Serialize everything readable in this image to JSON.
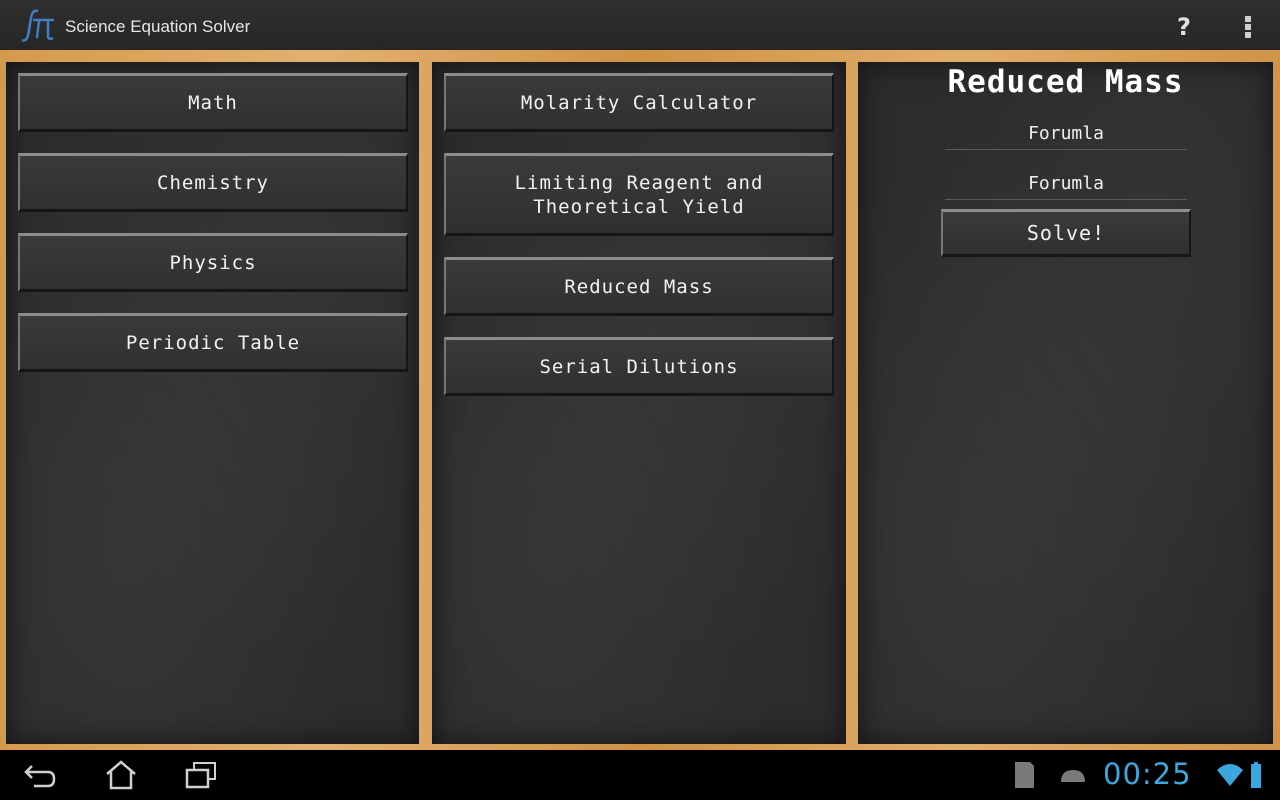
{
  "app": {
    "title": "Science Equation Solver",
    "logo_icon": "pi-formula-icon"
  },
  "actionbar": {
    "help_label": "?",
    "overflow_icon": "overflow-menu-icon"
  },
  "categories": [
    {
      "label": "Math"
    },
    {
      "label": "Chemistry"
    },
    {
      "label": "Physics"
    },
    {
      "label": "Periodic Table"
    }
  ],
  "equations": [
    {
      "label": "Molarity Calculator"
    },
    {
      "label": "Limiting Reagent and\nTheoretical Yield"
    },
    {
      "label": "Reduced Mass"
    },
    {
      "label": "Serial Dilutions"
    }
  ],
  "solver": {
    "title": "Reduced Mass",
    "field1": "Forumla",
    "field2": "Forumla",
    "solve_label": "Solve!"
  },
  "statusbar": {
    "time": "00:25"
  },
  "colors": {
    "chalkboard": "#2c2c2c",
    "wood": "#d9a25a",
    "clock": "#3aa7e0"
  }
}
